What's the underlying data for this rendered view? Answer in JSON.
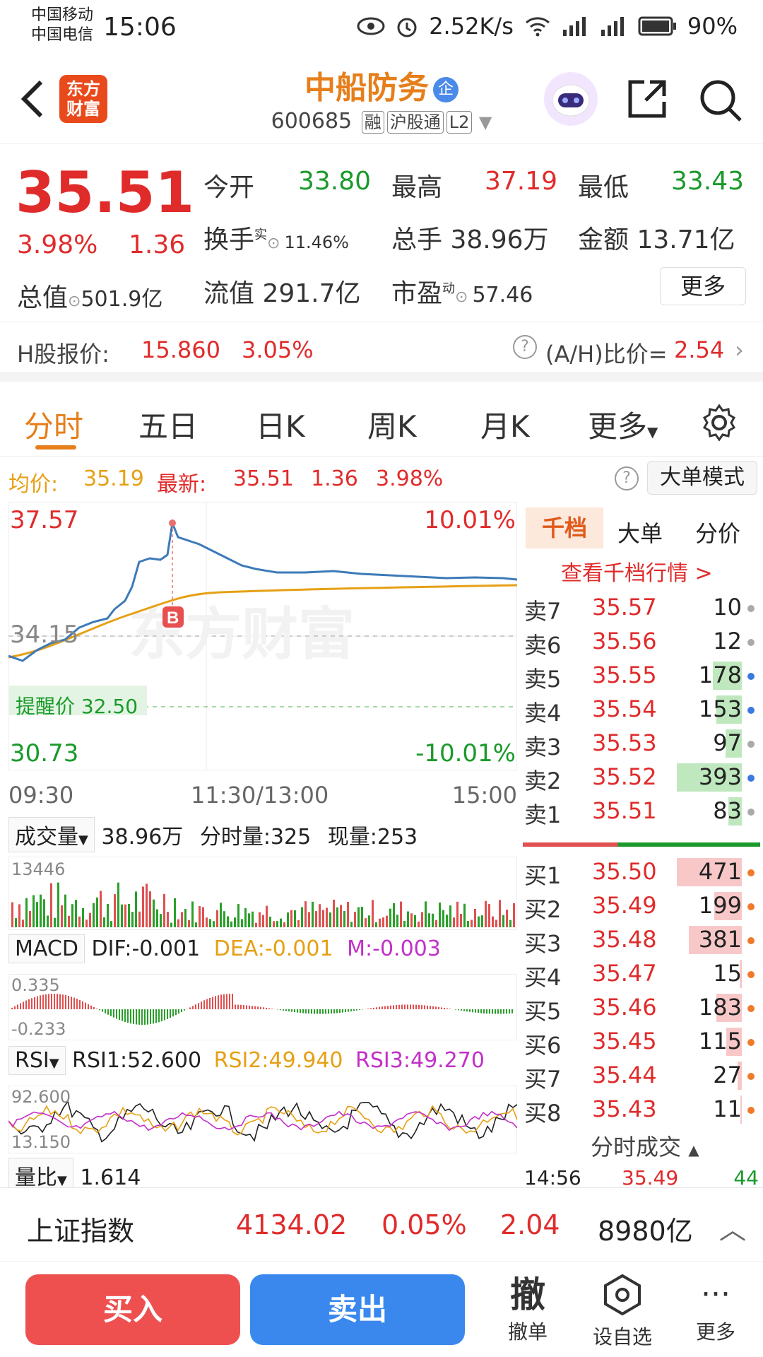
{
  "status_bar": {
    "carrier1": "中国移动",
    "carrier2": "中国电信",
    "time": "15:06",
    "net_speed": "2.52K/s",
    "battery": "90%"
  },
  "header": {
    "logo_line1": "东方",
    "logo_line2": "财富",
    "stock_name": "中船防务",
    "badge": "企",
    "code": "600685",
    "tag1": "融",
    "tag2": "沪股通",
    "tag3": "L2"
  },
  "quote": {
    "price": "35.51",
    "pct": "3.98%",
    "change": "1.36",
    "open_label": "今开",
    "open": "33.80",
    "high_label": "最高",
    "high": "37.19",
    "low_label": "最低",
    "low": "33.43",
    "turnover_label": "换手",
    "turnover_sup": "实",
    "turnover": "11.46%",
    "volume_label": "总手",
    "volume": "38.96万",
    "amount_label": "金额",
    "amount": "13.71亿",
    "mktcap_label": "总值",
    "mktcap": "501.9亿",
    "float_label": "流值",
    "float_cap": "291.7亿",
    "pe_label": "市盈",
    "pe_sup": "动",
    "pe": "57.46",
    "more": "更多"
  },
  "hshare": {
    "label": "H股报价:",
    "price": "15.860",
    "pct": "3.05%",
    "ratio_label": "(A/H)比价=",
    "ratio": "2.54"
  },
  "tabs": [
    "分时",
    "五日",
    "日K",
    "周K",
    "月K",
    "更多"
  ],
  "avg_line": {
    "avg_label": "均价:",
    "avg": "35.19",
    "latest_label": "最新:",
    "latest": "35.51",
    "chg": "1.36",
    "pct": "3.98%",
    "mode_btn": "大单模式"
  },
  "chart": {
    "y_top": "37.57",
    "y_mid": "34.15",
    "y_bottom": "30.73",
    "pct_top": "10.01%",
    "pct_bottom": "-10.01%",
    "alert": "提醒价 32.50",
    "marker": "B",
    "watermark": "东方财富",
    "t_start": "09:30",
    "t_mid": "11:30/13:00",
    "t_end": "15:00"
  },
  "volume_ind": {
    "name": "成交量",
    "total": "38.96万",
    "sub": "分时量:325",
    "cur": "现量:253",
    "ymax": "13446"
  },
  "macd_ind": {
    "name": "MACD",
    "dif": "DIF:-0.001",
    "dea": "DEA:-0.001",
    "m": "M:-0.003",
    "ymax": "0.335",
    "ymin": "-0.233"
  },
  "rsi_ind": {
    "name": "RSI",
    "rsi1": "RSI1:52.600",
    "rsi2": "RSI2:49.940",
    "rsi3": "RSI3:49.270",
    "ymax": "92.600",
    "ymin": "13.150"
  },
  "qr_ind": {
    "name": "量比",
    "value": "1.614"
  },
  "book": {
    "tabs": [
      "千档",
      "大单",
      "分价"
    ],
    "link": "查看千档行情 >",
    "sells": [
      {
        "label": "卖7",
        "price": "35.57",
        "vol": "10",
        "bar": 0
      },
      {
        "label": "卖6",
        "price": "35.56",
        "vol": "12",
        "bar": 0
      },
      {
        "label": "卖5",
        "price": "35.55",
        "vol": "178",
        "bar": 0.45
      },
      {
        "label": "卖4",
        "price": "35.54",
        "vol": "153",
        "bar": 0.39
      },
      {
        "label": "卖3",
        "price": "35.53",
        "vol": "97",
        "bar": 0.25
      },
      {
        "label": "卖2",
        "price": "35.52",
        "vol": "393",
        "bar": 1
      },
      {
        "label": "卖1",
        "price": "35.51",
        "vol": "83",
        "bar": 0.21
      }
    ],
    "buys": [
      {
        "label": "买1",
        "price": "35.50",
        "vol": "471",
        "bar": 1
      },
      {
        "label": "买2",
        "price": "35.49",
        "vol": "199",
        "bar": 0.42
      },
      {
        "label": "买3",
        "price": "35.48",
        "vol": "381",
        "bar": 0.81
      },
      {
        "label": "买4",
        "price": "35.47",
        "vol": "15",
        "bar": 0.03
      },
      {
        "label": "买5",
        "price": "35.46",
        "vol": "183",
        "bar": 0.39
      },
      {
        "label": "买6",
        "price": "35.45",
        "vol": "115",
        "bar": 0.24
      },
      {
        "label": "买7",
        "price": "35.44",
        "vol": "27",
        "bar": 0.06
      },
      {
        "label": "买8",
        "price": "35.43",
        "vol": "11",
        "bar": 0.02
      }
    ],
    "trades_title": "分时成交",
    "trade": {
      "time": "14:56",
      "price": "35.49",
      "vol": "44"
    }
  },
  "index_bar": {
    "name": "上证指数",
    "value": "4134.02",
    "pct": "0.05%",
    "chg": "2.04",
    "amount": "8980亿"
  },
  "bottom": {
    "buy": "买入",
    "sell": "卖出",
    "cancel_glyph": "撤",
    "cancel": "撤单",
    "watch": "设自选",
    "more": "更多"
  }
}
